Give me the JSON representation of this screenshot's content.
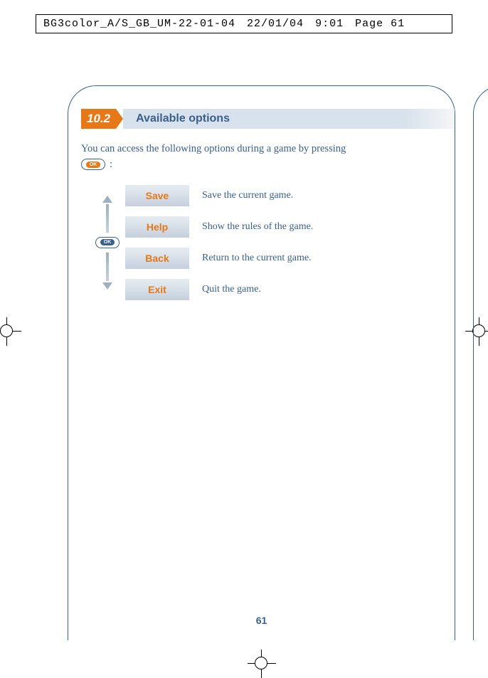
{
  "meta": {
    "filename": "BG3color_A/S_GB_UM-22-01-04",
    "date": "22/01/04",
    "time": "9:01",
    "page_label": "Page 61"
  },
  "section": {
    "number": "10.2",
    "title": "Available options"
  },
  "intro": {
    "text": "You can access the following options during a game by pressing",
    "ok_label": "OK",
    "colon": ":"
  },
  "nav": {
    "ok_label": "OK"
  },
  "options": [
    {
      "label": "Save",
      "desc": "Save the current game."
    },
    {
      "label": "Help",
      "desc": "Show the rules of the game."
    },
    {
      "label": "Back",
      "desc": "Return to the current game."
    },
    {
      "label": "Exit",
      "desc": "Quit the game."
    }
  ],
  "page_number": "61"
}
